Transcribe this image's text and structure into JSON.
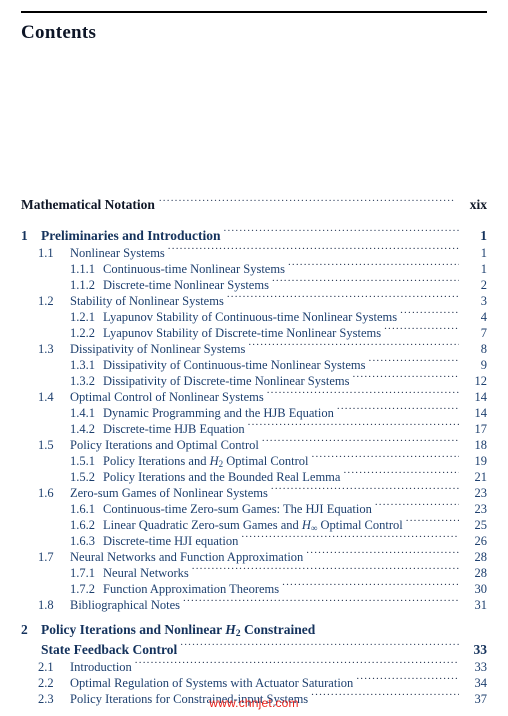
{
  "document": {
    "title": "Contents",
    "watermark": "www.chnjet.com"
  },
  "front_matter": [
    {
      "number": "",
      "title": "Mathematical Notation",
      "page": "xix"
    }
  ],
  "toc": [
    {
      "level": 1,
      "number": "1",
      "title": "Preliminaries and Introduction",
      "page": "1",
      "children": [
        {
          "level": 2,
          "number": "1.1",
          "title": "Nonlinear Systems",
          "page": "1",
          "children": [
            {
              "level": 3,
              "number": "1.1.1",
              "title": "Continuous-time Nonlinear Systems",
              "page": "1"
            },
            {
              "level": 3,
              "number": "1.1.2",
              "title": "Discrete-time Nonlinear Systems",
              "page": "2"
            }
          ]
        },
        {
          "level": 2,
          "number": "1.2",
          "title": "Stability of Nonlinear Systems",
          "page": "3",
          "children": [
            {
              "level": 3,
              "number": "1.2.1",
              "title": "Lyapunov Stability of Continuous-time Nonlinear Systems",
              "page": "4"
            },
            {
              "level": 3,
              "number": "1.2.2",
              "title": "Lyapunov Stability of Discrete-time Nonlinear Systems",
              "page": "7"
            }
          ]
        },
        {
          "level": 2,
          "number": "1.3",
          "title": "Dissipativity of Nonlinear Systems",
          "page": "8",
          "children": [
            {
              "level": 3,
              "number": "1.3.1",
              "title": "Dissipativity of Continuous-time Nonlinear Systems",
              "page": "9"
            },
            {
              "level": 3,
              "number": "1.3.2",
              "title": "Dissipativity of Discrete-time Nonlinear Systems",
              "page": "12"
            }
          ]
        },
        {
          "level": 2,
          "number": "1.4",
          "title": "Optimal Control of Nonlinear Systems",
          "page": "14",
          "children": [
            {
              "level": 3,
              "number": "1.4.1",
              "title": "Dynamic Programming and the HJB Equation",
              "page": "14"
            },
            {
              "level": 3,
              "number": "1.4.2",
              "title": "Discrete-time HJB Equation",
              "page": "17"
            }
          ]
        },
        {
          "level": 2,
          "number": "1.5",
          "title": "Policy Iterations and Optimal Control",
          "page": "18",
          "children": [
            {
              "level": 3,
              "number": "1.5.1",
              "title_pre": "Policy Iterations and ",
              "math": "H",
              "math_sub": "2",
              "title_post": " Optimal Control",
              "page": "19"
            },
            {
              "level": 3,
              "number": "1.5.2",
              "title": "Policy Iterations and the Bounded Real Lemma",
              "page": "21"
            }
          ]
        },
        {
          "level": 2,
          "number": "1.6",
          "title": "Zero-sum Games of Nonlinear Systems",
          "page": "23",
          "children": [
            {
              "level": 3,
              "number": "1.6.1",
              "title": "Continuous-time Zero-sum Games: The HJI Equation",
              "page": "23"
            },
            {
              "level": 3,
              "number": "1.6.2",
              "title_pre": "Linear Quadratic Zero-sum Games and ",
              "math": "H",
              "math_sub": "∞",
              "title_post": " Optimal Control",
              "page": "25"
            },
            {
              "level": 3,
              "number": "1.6.3",
              "title": "Discrete-time HJI equation",
              "page": "26"
            }
          ]
        },
        {
          "level": 2,
          "number": "1.7",
          "title": "Neural Networks and Function Approximation",
          "page": "28",
          "children": [
            {
              "level": 3,
              "number": "1.7.1",
              "title": "Neural Networks",
              "page": "28"
            },
            {
              "level": 3,
              "number": "1.7.2",
              "title": "Function Approximation Theorems",
              "page": "30"
            }
          ]
        },
        {
          "level": 2,
          "number": "1.8",
          "title": "Bibliographical Notes",
          "page": "31",
          "children": []
        }
      ]
    },
    {
      "level": 1,
      "number": "2",
      "title_line1_pre": "Policy Iterations and Nonlinear ",
      "math": "H",
      "math_sub": "2",
      "title_line1_post": " Constrained",
      "title_line2": "State Feedback Control",
      "page": "33",
      "children": [
        {
          "level": 2,
          "number": "2.1",
          "title": "Introduction",
          "page": "33"
        },
        {
          "level": 2,
          "number": "2.2",
          "title": "Optimal Regulation of Systems with Actuator Saturation",
          "page": "34"
        },
        {
          "level": 2,
          "number": "2.3",
          "title": "Policy Iterations for Constrained-input Systems",
          "page": "37"
        }
      ]
    }
  ]
}
